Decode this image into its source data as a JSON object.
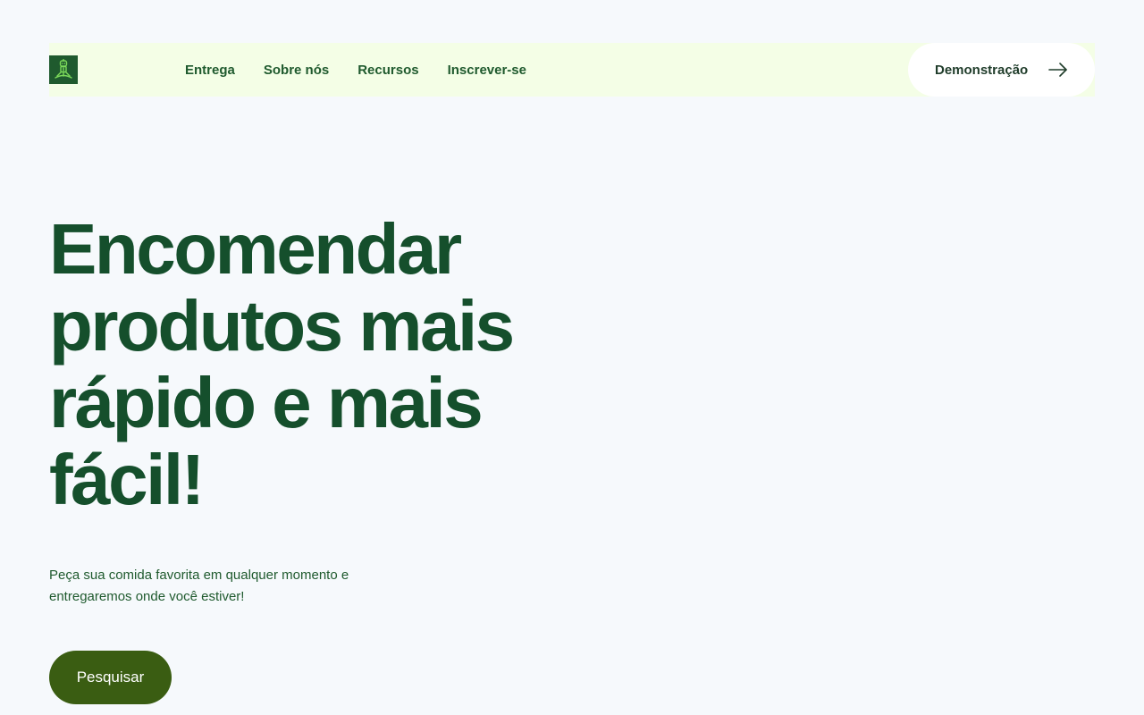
{
  "header": {
    "logo_icon": "tower-robot-logo-icon",
    "nav": [
      {
        "label": "Entrega"
      },
      {
        "label": "Sobre nós"
      },
      {
        "label": "Recursos"
      },
      {
        "label": "Inscrever-se"
      }
    ],
    "demo_button": {
      "label": "Demonstração",
      "icon": "arrow-right-icon"
    }
  },
  "hero": {
    "title": "Encomendar produtos mais rápido e mais fácil!",
    "subtitle": "Peça sua comida favorita em qualquer momento e entregaremos onde você estiver!",
    "search_button_label": "Pesquisar"
  },
  "colors": {
    "background": "#f6f9fc",
    "header_bg": "#f4fee6",
    "primary_text": "#154f2c",
    "button_bg": "#3a5d12",
    "logo_bg": "#1f5a2e",
    "logo_accent": "#7bd95a"
  }
}
